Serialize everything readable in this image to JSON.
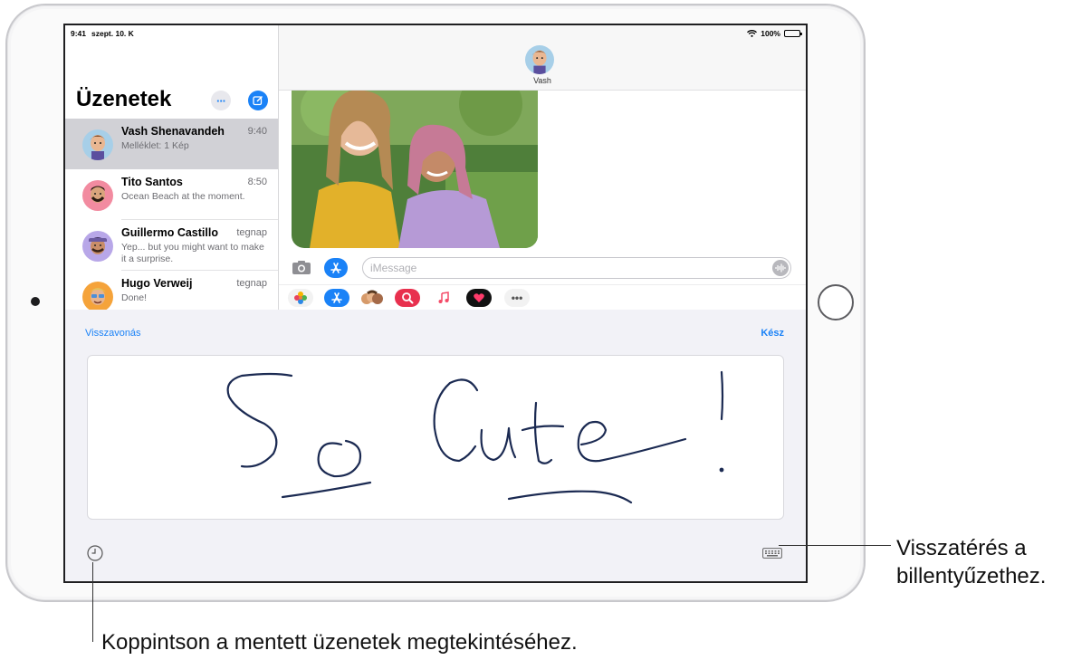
{
  "status_bar": {
    "time": "9:41",
    "date": "szept. 10. K",
    "battery": "100%"
  },
  "sidebar": {
    "title": "Üzenetek",
    "more_label": "···",
    "conversations": [
      {
        "name": "Vash Shenavandeh",
        "time": "9:40",
        "preview": "Melléklet: 1 Kép",
        "selected": true
      },
      {
        "name": "Tito Santos",
        "time": "8:50",
        "preview": "Ocean Beach at the moment."
      },
      {
        "name": "Guillermo Castillo",
        "time": "tegnap",
        "preview": "Yep... but you might want to make it a surprise."
      },
      {
        "name": "Hugo Verweij",
        "time": "tegnap",
        "preview": "Done!"
      }
    ]
  },
  "conversation": {
    "contact_name": "Vash",
    "input_placeholder": "iMessage",
    "app_drawer": [
      "photos-icon",
      "appstore-icon",
      "memoji-icon",
      "search-images-icon",
      "music-icon",
      "digital-touch-icon",
      "more-apps-icon"
    ]
  },
  "handwriting": {
    "undo_label": "Visszavonás",
    "done_label": "Kész",
    "handwritten_text": "So Cute!"
  },
  "callouts": {
    "keyboard_line1": "Visszatérés a",
    "keyboard_line2": "billentyűzethez.",
    "saved_messages": "Koppintson a mentett üzenetek megtekintéséhez."
  },
  "colors": {
    "accent": "#1a82f7",
    "selected_row": "#d1d1d6",
    "ink": "#1b2a52"
  }
}
